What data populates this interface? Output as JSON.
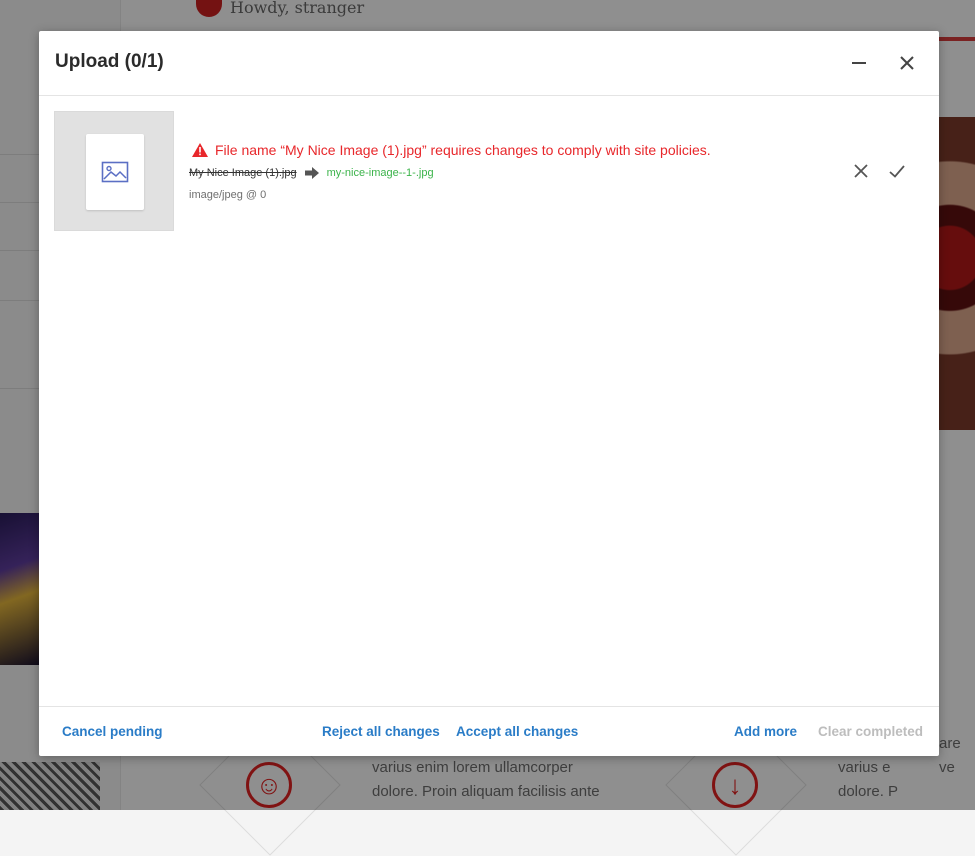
{
  "background": {
    "greeting": "Howdy, stranger",
    "text_lines_left": [
      "varius enim lorem ullamcorper",
      "dolore. Proin aliquam facilisis ante"
    ],
    "text_lines_right": [
      "are ve",
      "varius e",
      "dolore. P"
    ],
    "accent_color": "#d22222"
  },
  "modal": {
    "title": "Upload (0/1)",
    "minimize_icon": "minimize-icon",
    "close_icon": "close-icon"
  },
  "file": {
    "warning_icon": "warning-triangle-icon",
    "warning_text": "File name “My Nice Image (1).jpg” requires changes to comply with site policies.",
    "original_name": "My Nice Image (1).jpg",
    "arrow_icon": "arrow-right-icon",
    "suggested_name": "my-nice-image--1-.jpg",
    "meta": "image/jpeg @ 0",
    "thumbnail_icon": "image-placeholder-icon",
    "reject_icon": "close-icon",
    "accept_icon": "check-icon"
  },
  "footer": {
    "cancel_pending": "Cancel pending",
    "reject_all": "Reject all changes",
    "accept_all": "Accept all changes",
    "add_more": "Add more",
    "clear_completed": "Clear completed"
  },
  "colors": {
    "warning": "#e8272b",
    "suggested": "#3bb34a",
    "link": "#2a7cc7",
    "disabled": "#bdbdbd"
  }
}
